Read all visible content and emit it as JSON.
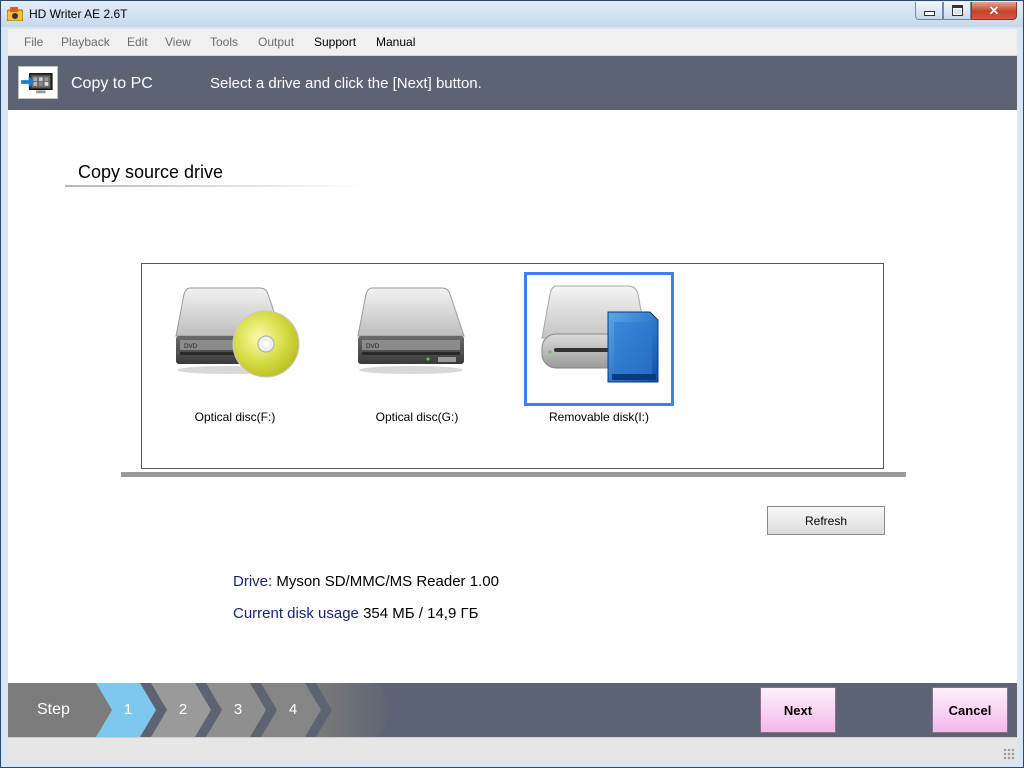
{
  "window": {
    "title": "HD Writer AE 2.6T",
    "close_glyph": "✕"
  },
  "menu": [
    {
      "label": "File",
      "active": false
    },
    {
      "label": "Playback",
      "active": false
    },
    {
      "label": "Edit",
      "active": false
    },
    {
      "label": "View",
      "active": false
    },
    {
      "label": "Tools",
      "active": false
    },
    {
      "label": "Output",
      "active": false
    },
    {
      "label": "Support",
      "active": true
    },
    {
      "label": "Manual",
      "active": true
    }
  ],
  "header": {
    "title": "Copy to PC",
    "instruction": "Select a drive and click the [Next] button."
  },
  "section": {
    "title": "Copy source drive"
  },
  "drives": [
    {
      "label": "Optical disc(F:)",
      "icon": "optical-drive-with-disc-icon",
      "selected": false
    },
    {
      "label": "Optical disc(G:)",
      "icon": "optical-drive-icon",
      "selected": false
    },
    {
      "label": "Removable disk(I:)",
      "icon": "removable-disk-sd-card-icon",
      "selected": true
    }
  ],
  "refresh_label": "Refresh",
  "info": {
    "drive_label": "Drive:",
    "drive_value": "Myson SD/MMC/MS Reader 1.00",
    "usage_label": "Current disk usage",
    "usage_value": "354 МБ / 14,9 ГБ"
  },
  "steps": {
    "label": "Step",
    "items": [
      "1",
      "2",
      "3",
      "4"
    ],
    "current": "1"
  },
  "buttons": {
    "next": "Next",
    "cancel": "Cancel"
  },
  "colors": {
    "header_bg": "#5c6373",
    "step_active": "#7ec8ee",
    "step_inactive": "#9a9a9a",
    "selection": "#3f7ff0",
    "info_label": "#1a237e"
  }
}
